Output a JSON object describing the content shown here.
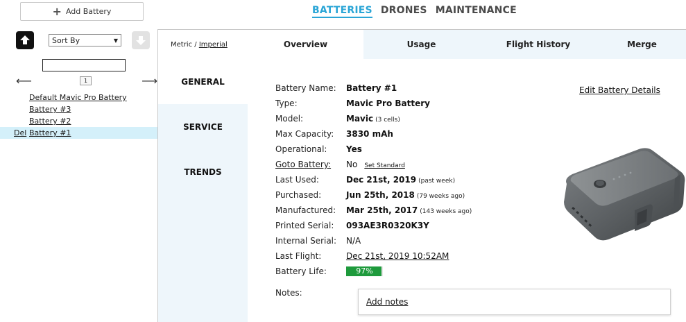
{
  "toolbar": {
    "add_battery_label": "Add Battery"
  },
  "top_nav": {
    "batteries": "BATTERIES",
    "drones": "DRONES",
    "maintenance": "MAINTENANCE"
  },
  "list_panel": {
    "sort_by": "Sort By",
    "page_number": "1",
    "items": [
      {
        "label": "Default Mavic Pro Battery"
      },
      {
        "label": "Battery #3"
      },
      {
        "label": "Battery #2"
      },
      {
        "label": "Battery #1",
        "delete_label": "Del",
        "selected": true
      }
    ]
  },
  "units": {
    "metric": "Metric / ",
    "imperial": "Imperial"
  },
  "tabs": {
    "overview": "Overview",
    "usage": "Usage",
    "flight_history": "Flight History",
    "merge": "Merge"
  },
  "side_menu": {
    "general": "GENERAL",
    "service": "SERVICE",
    "trends": "TRENDS"
  },
  "details": {
    "battery_name": {
      "label": "Battery Name:",
      "value": "Battery #1"
    },
    "type": {
      "label": "Type:",
      "value": "Mavic Pro Battery"
    },
    "model": {
      "label": "Model:",
      "value": "Mavic",
      "note": "(3 cells)"
    },
    "max_capacity": {
      "label": "Max Capacity:",
      "value": "3830 mAh"
    },
    "operational": {
      "label": "Operational:",
      "value": "Yes"
    },
    "goto_battery": {
      "label": "Goto Battery:",
      "value": "No",
      "action": "Set Standard"
    },
    "last_used": {
      "label": "Last Used:",
      "value": "Dec 21st, 2019",
      "note": "(past week)"
    },
    "purchased": {
      "label": "Purchased:",
      "value": "Jun 25th, 2018",
      "note": "(79 weeks ago)"
    },
    "manufactured": {
      "label": "Manufactured:",
      "value": "Mar 25th, 2017",
      "note": "(143 weeks ago)"
    },
    "printed_serial": {
      "label": "Printed Serial:",
      "value": "093AE3R0320K3Y"
    },
    "internal_serial": {
      "label": "Internal Serial:",
      "value": "N/A"
    },
    "last_flight": {
      "label": "Last Flight:",
      "value": "Dec 21st, 2019 10:52AM"
    },
    "battery_life": {
      "label": "Battery Life:",
      "value": "97%",
      "percent": 97
    }
  },
  "edit_details": "Edit Battery Details",
  "notes": {
    "label": "Notes:",
    "add_notes": "Add notes"
  },
  "colors": {
    "accent": "#2aa5d6",
    "life_bar": "#1e9a3c",
    "tab_bg": "#eef6fb",
    "selected_row": "#d4f0fa"
  },
  "icons": {
    "add": "plus-icon",
    "up": "arrow-up-icon",
    "down": "arrow-down-icon",
    "prev": "arrow-left-icon",
    "next": "arrow-right-icon",
    "battery_image": "battery-image"
  }
}
